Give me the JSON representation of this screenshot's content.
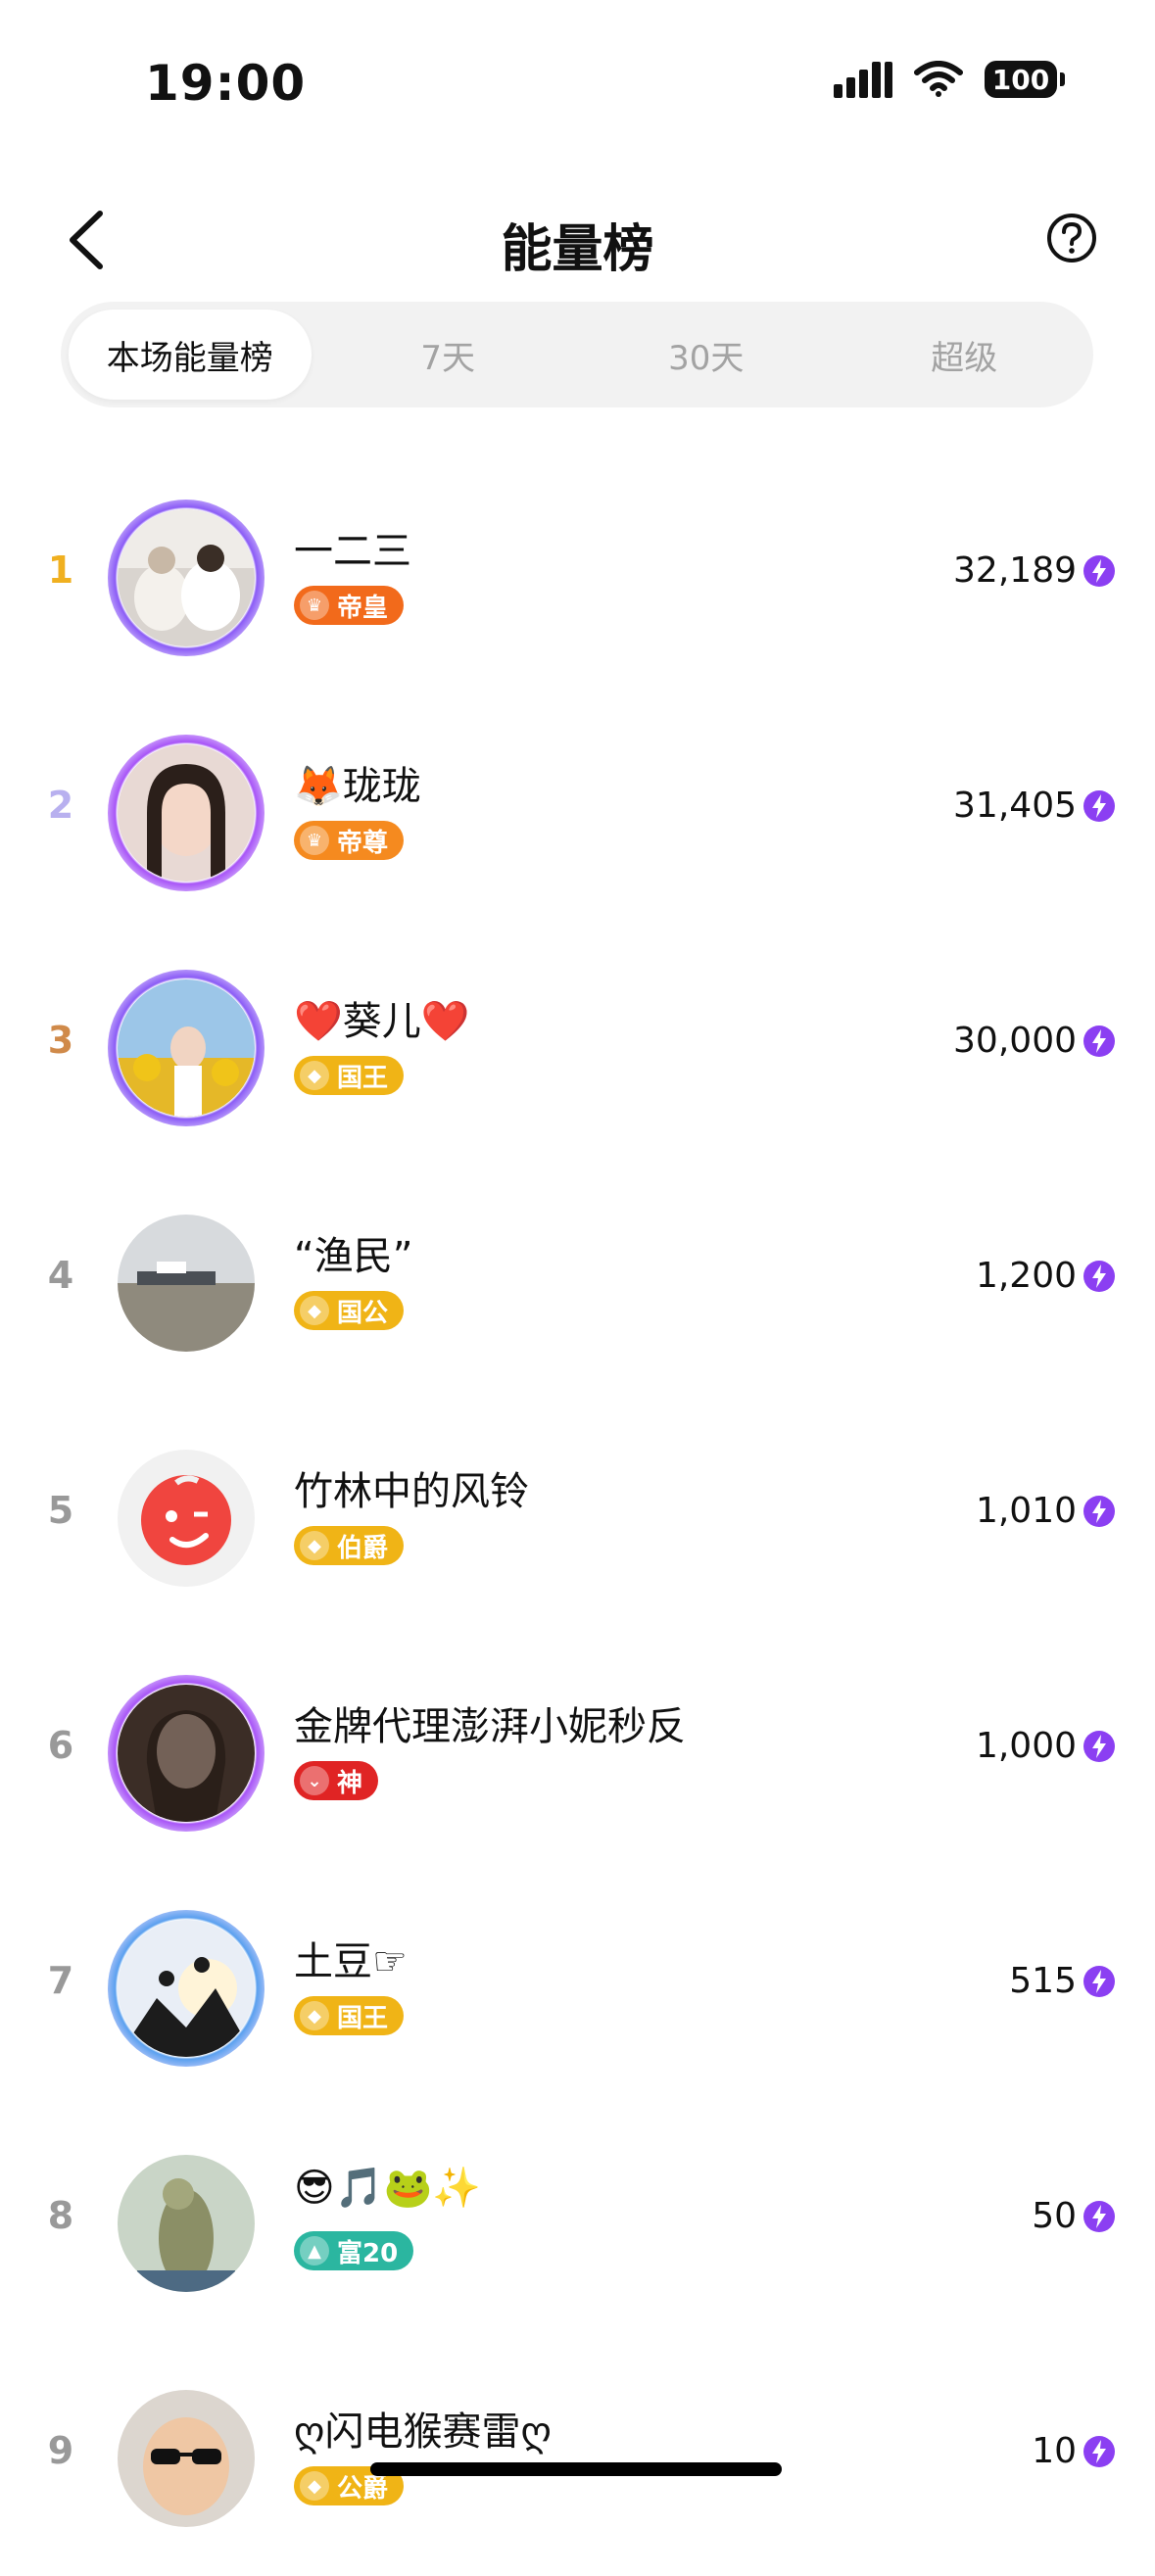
{
  "status": {
    "time": "19:00",
    "battery": "100"
  },
  "nav": {
    "title": "能量榜"
  },
  "tabs": [
    "本场能量榜",
    "7天",
    "30天",
    "超级"
  ],
  "rows": [
    {
      "rank": "1",
      "rank_color": "#f0b020",
      "name": "一二三",
      "badge": "帝皇",
      "badge_color": "#f26a1b",
      "score": "32,189",
      "frame_color": "#8b5cf6"
    },
    {
      "rank": "2",
      "rank_color": "#b8b0ef",
      "name": "🦊珑珑",
      "badge": "帝尊",
      "badge_color": "#f58a1f",
      "score": "31,405",
      "frame_color": "#a855f7"
    },
    {
      "rank": "3",
      "rank_color": "#d08a4a",
      "name": "❤️葵儿❤️",
      "badge": "国王",
      "badge_color": "#f0b416",
      "score": "30,000",
      "frame_color": "#8b5cf6"
    },
    {
      "rank": "4",
      "rank_color": "#999999",
      "name": "“渔民”",
      "badge": "国公",
      "badge_color": "#f0b416",
      "score": "1,200",
      "frame_color": "#ffffff"
    },
    {
      "rank": "5",
      "rank_color": "#999999",
      "name": "竹林中的风铃",
      "badge": "伯爵",
      "badge_color": "#f0b416",
      "score": "1,010",
      "frame_color": "#ffffff"
    },
    {
      "rank": "6",
      "rank_color": "#999999",
      "name": "金牌代理澎湃小妮秒反",
      "badge": "神",
      "badge_color": "#e02424",
      "score": "1,000",
      "frame_color": "#a855f7"
    },
    {
      "rank": "7",
      "rank_color": "#999999",
      "name": "土豆☞",
      "badge": "国王",
      "badge_color": "#f0b416",
      "score": "515",
      "frame_color": "#5aa0ef"
    },
    {
      "rank": "8",
      "rank_color": "#999999",
      "name": "😎🎵🐸✨",
      "badge": "富20",
      "badge_color": "#2bb6a0",
      "score": "50",
      "frame_color": "#ffffff"
    },
    {
      "rank": "9",
      "rank_color": "#999999",
      "name": "ღ闪电猴赛雷ღ",
      "badge": "公爵",
      "badge_color": "#f0b416",
      "score": "10",
      "frame_color": "#ffffff"
    }
  ],
  "icons": {
    "back": "chevron-left-icon",
    "help": "question-circle-icon",
    "energy": "lightning-bolt-icon"
  }
}
